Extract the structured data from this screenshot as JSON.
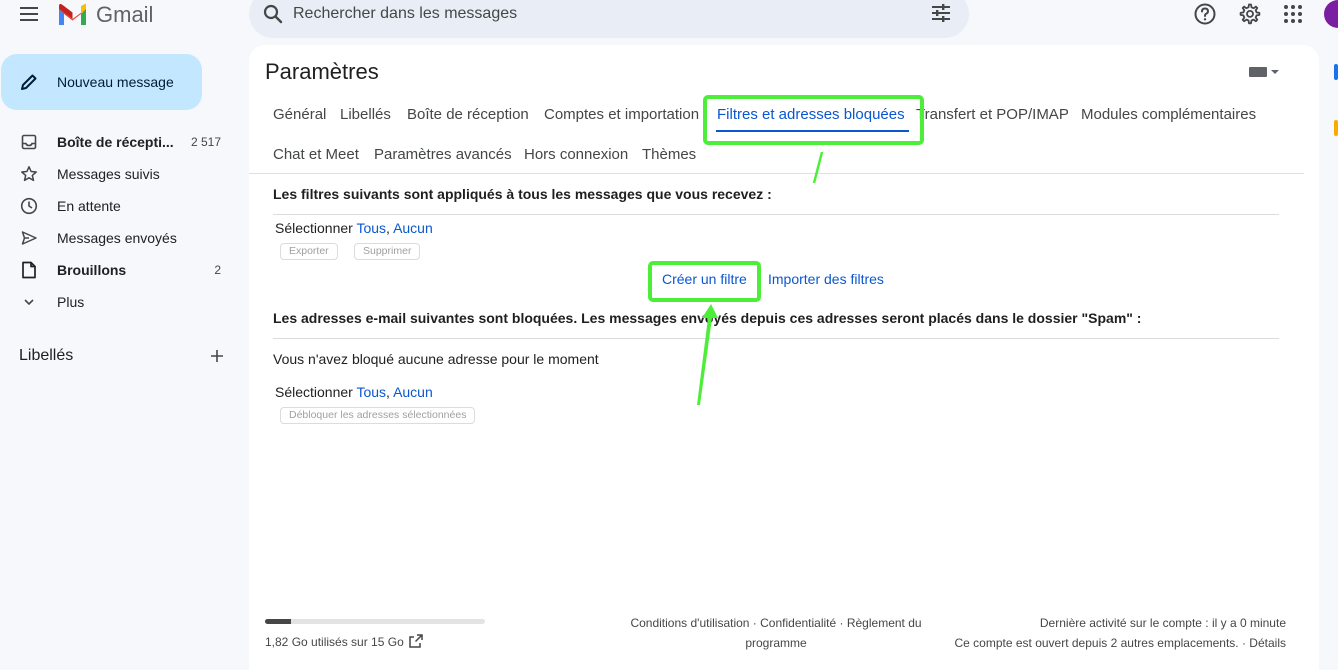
{
  "app": {
    "name": "Gmail"
  },
  "search": {
    "placeholder": "Rechercher dans les messages"
  },
  "compose": {
    "label": "Nouveau message"
  },
  "sidebar": {
    "items": [
      {
        "label": "Boîte de récepti...",
        "count": "2 517",
        "icon": "inbox-icon",
        "bold": true
      },
      {
        "label": "Messages suivis",
        "count": "",
        "icon": "star-icon",
        "bold": false
      },
      {
        "label": "En attente",
        "count": "",
        "icon": "clock-icon",
        "bold": false
      },
      {
        "label": "Messages envoyés",
        "count": "",
        "icon": "send-icon",
        "bold": false
      },
      {
        "label": "Brouillons",
        "count": "2",
        "icon": "draft-icon",
        "bold": true
      },
      {
        "label": "Plus",
        "count": "",
        "icon": "chevron-down-icon",
        "bold": false
      }
    ],
    "labels_title": "Libellés"
  },
  "settings": {
    "title": "Paramètres",
    "tabs": [
      {
        "label": "Général"
      },
      {
        "label": "Libellés"
      },
      {
        "label": "Boîte de réception"
      },
      {
        "label": "Comptes et importation"
      },
      {
        "label": "Filtres et adresses bloquées",
        "active": true
      },
      {
        "label": "Transfert et POP/IMAP"
      },
      {
        "label": "Modules complémentaires"
      },
      {
        "label": "Chat et Meet"
      },
      {
        "label": "Paramètres avancés"
      },
      {
        "label": "Hors connexion"
      },
      {
        "label": "Thèmes"
      }
    ],
    "filters": {
      "heading": "Les filtres suivants sont appliqués à tous les messages que vous recevez :",
      "select_label": "Sélectionner",
      "all": "Tous",
      "none": "Aucun",
      "export_label": "Exporter",
      "delete_label": "Supprimer",
      "create_label": "Créer un filtre",
      "import_label": "Importer des filtres"
    },
    "blocked": {
      "heading": "Les adresses e-mail suivantes sont bloquées. Les messages envoyés depuis ces adresses seront placés dans le dossier \"Spam\" :",
      "empty_text": "Vous n'avez bloqué aucune adresse pour le moment",
      "select_label": "Sélectionner",
      "all": "Tous",
      "none": "Aucun",
      "unblock_label": "Débloquer les adresses sélectionnées"
    }
  },
  "footer": {
    "storage_text": "1,82 Go utilisés sur 15 Go",
    "storage_fraction": 0.12,
    "links_line1": "Conditions d'utilisation · Confidentialité · Règlement du",
    "links_line2": "programme",
    "activity_line1": "Dernière activité sur le compte : il y a 0 minute",
    "activity_line2": "Ce compte est ouvert depuis 2 autres emplacements. · Détails"
  },
  "colors": {
    "accent": "#0b57d0",
    "compose_bg": "#c2e7ff",
    "annotation": "#4cee3a",
    "avatar": "#7b1fa2"
  }
}
